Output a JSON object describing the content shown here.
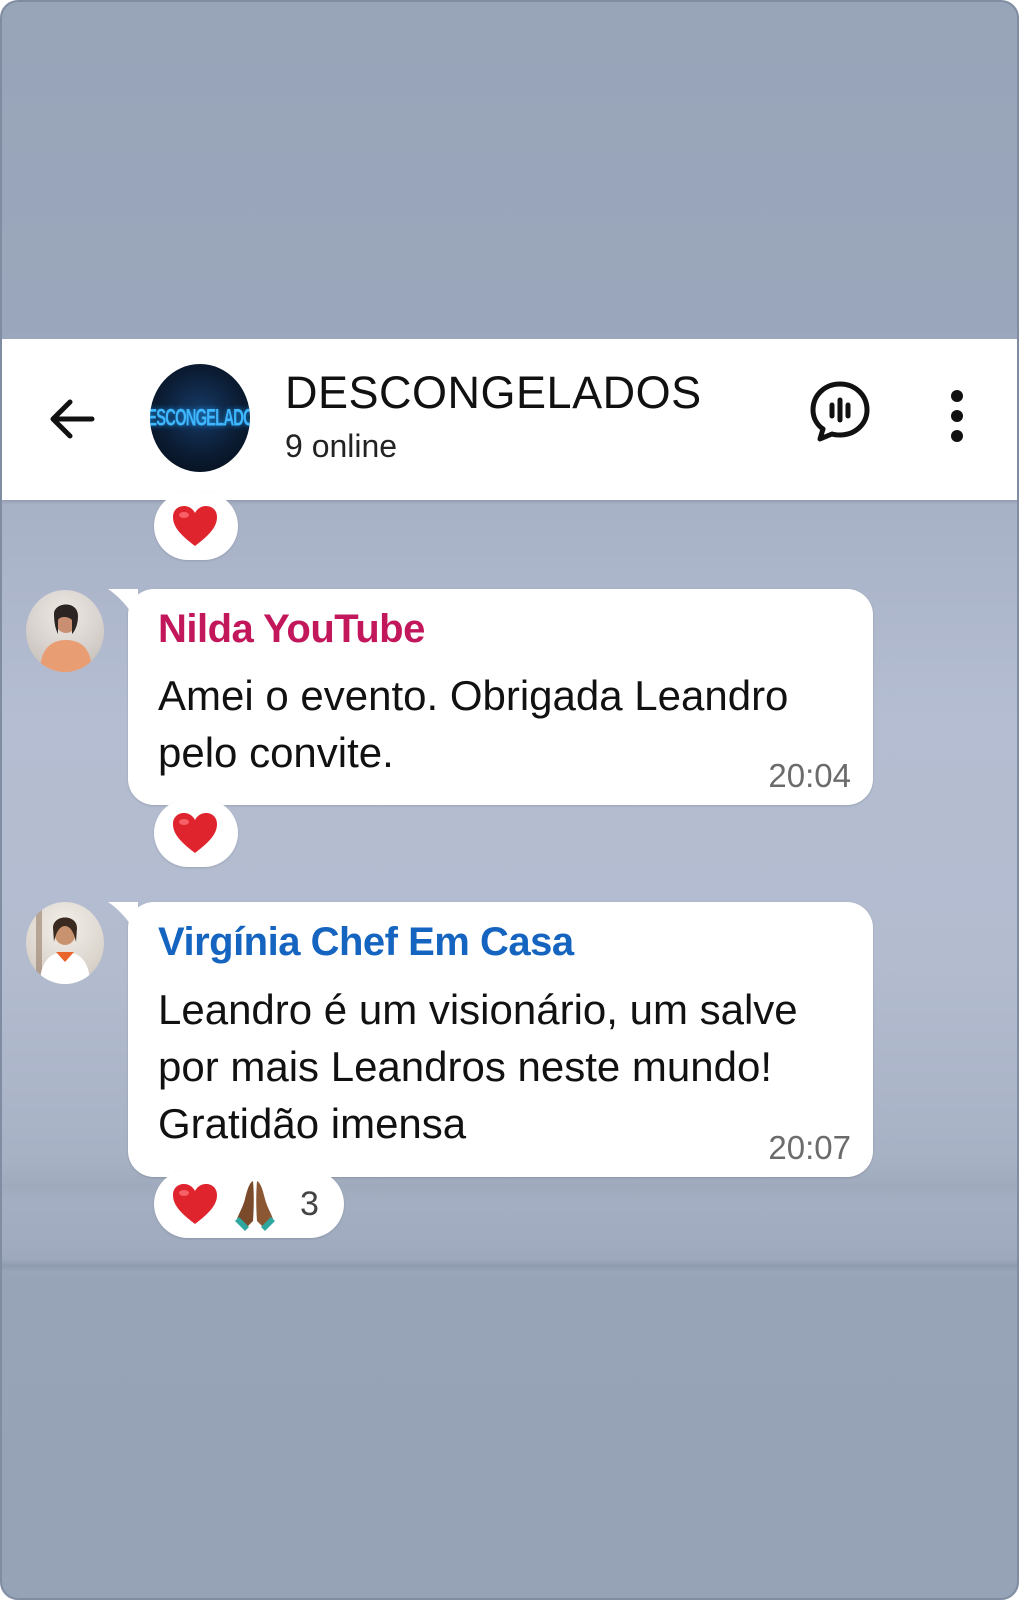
{
  "chat": {
    "title": "DESCONGELADOS",
    "status": "9 online",
    "avatar_logo_text": "DESCONGELADOS"
  },
  "messages": [
    {
      "sender": "Nilda YouTube",
      "sender_color": "#c2185b",
      "text_lines": [
        "Amei o evento. Obrigada Leandro",
        "pelo convite."
      ],
      "time": "20:04",
      "reactions": [
        {
          "emoji": "red-heart-icon"
        }
      ]
    },
    {
      "sender": "Virgínia Chef Em Casa",
      "sender_color": "#1565c0",
      "text_lines": [
        "Leandro é um visionário, um salve",
        "por mais Leandros neste mundo!",
        "Gratidão imensa"
      ],
      "time": "20:07",
      "reactions": [
        {
          "emoji": "red-heart-icon"
        },
        {
          "emoji": "folded-hands-icon"
        }
      ],
      "reaction_count": "3"
    }
  ],
  "previous_message": {
    "reactions": [
      {
        "emoji": "red-heart-icon"
      }
    ]
  },
  "colors": {
    "header_bg": "#ffffff",
    "bubble_bg": "#ffffff",
    "heart": "#e0242d"
  }
}
